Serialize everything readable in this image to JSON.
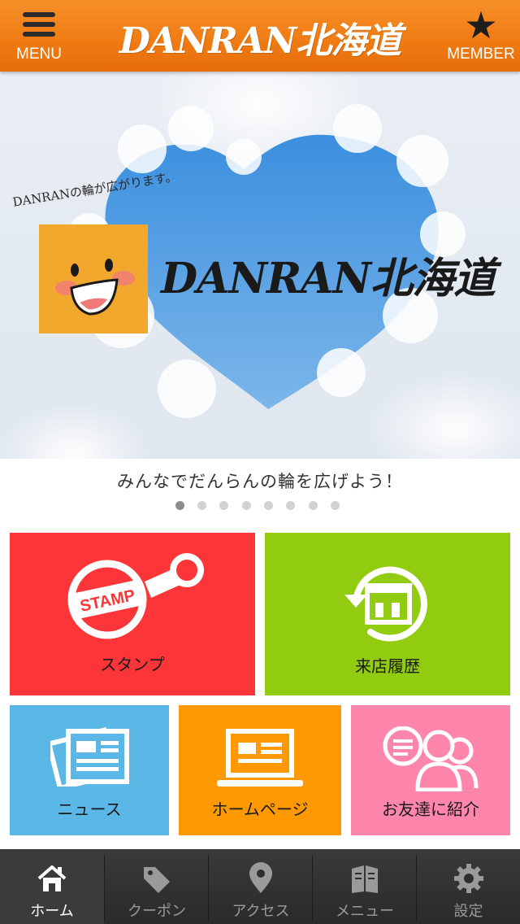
{
  "header": {
    "menu_label": "MENU",
    "brand": "DANRAN北海道",
    "member_label": "MEMBER"
  },
  "hero": {
    "tagline": "DANRANの輪が広がります。",
    "brand": "DANRAN北海道",
    "caption": "みんなでだんらんの輪を広げよう！",
    "slide_count": 8,
    "active_slide": 1
  },
  "tiles": [
    {
      "label": "スタンプ",
      "icon": "stamp-icon",
      "badge": "STAMP",
      "color": "#fb3538"
    },
    {
      "label": "来店履歴",
      "icon": "store-history-icon",
      "color": "#92cc10"
    },
    {
      "label": "ニュース",
      "icon": "newspaper-icon",
      "color": "#5bb7e6"
    },
    {
      "label": "ホームページ",
      "icon": "laptop-icon",
      "color": "#fe9901"
    },
    {
      "label": "お友達に紹介",
      "icon": "friends-chat-icon",
      "color": "#fd86aa"
    }
  ],
  "tabbar": {
    "tabs": [
      {
        "label": "ホーム",
        "icon": "home-icon",
        "active": true
      },
      {
        "label": "クーポン",
        "icon": "tag-icon",
        "active": false
      },
      {
        "label": "アクセス",
        "icon": "map-pin-icon",
        "active": false
      },
      {
        "label": "メニュー",
        "icon": "book-icon",
        "active": false
      },
      {
        "label": "設定",
        "icon": "gear-icon",
        "active": false
      }
    ]
  }
}
